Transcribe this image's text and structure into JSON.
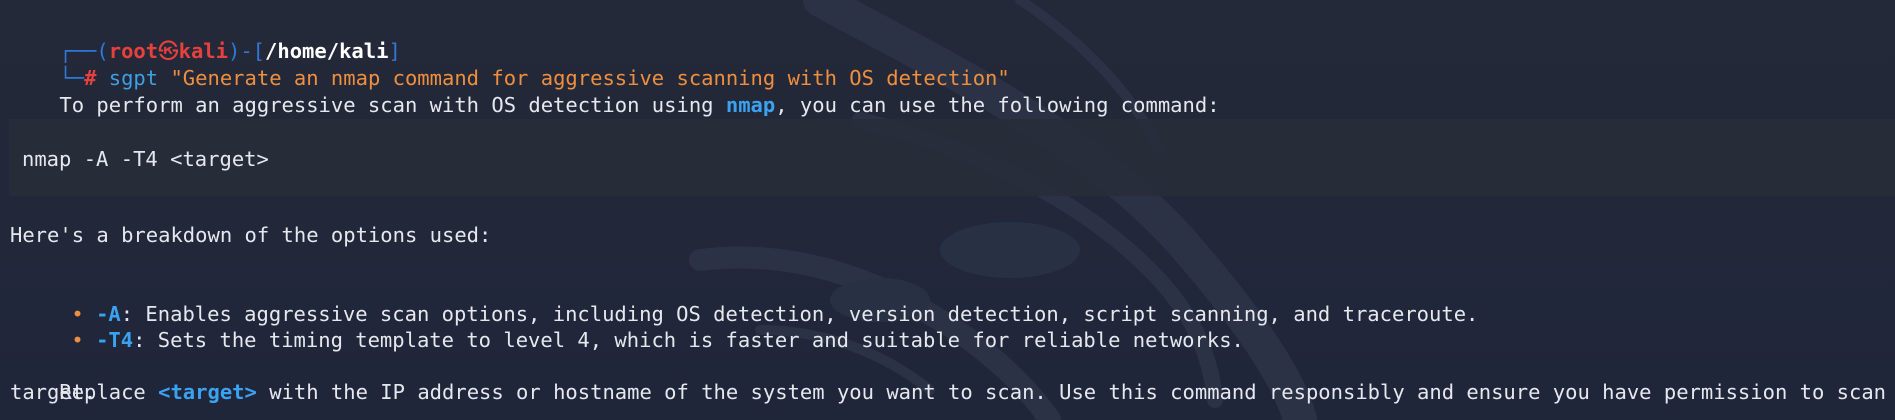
{
  "prompt": {
    "box_top": "┌──(",
    "user": "root",
    "skull": "㉿",
    "host": "kali",
    "close_paren": ")-[",
    "path": "/home/kali",
    "close_bracket": "]",
    "box_bottom": "└─",
    "hash": "#",
    "command": "sgpt",
    "argument": "\"Generate an nmap command for aggressive scanning with OS detection\""
  },
  "output": {
    "intro_before": "To perform an aggressive scan with OS detection using ",
    "intro_highlight": "nmap",
    "intro_after": ", you can use the following command:",
    "code": "nmap -A -T4 <target>",
    "breakdown_heading": "Here's a breakdown of the options used:",
    "bullets": [
      {
        "marker": "•",
        "option": "-A",
        "text": ": Enables aggressive scan options, including OS detection, version detection, script scanning, and traceroute."
      },
      {
        "marker": "•",
        "option": "-T4",
        "text": ": Sets the timing template to level 4, which is faster and suitable for reliable networks."
      }
    ],
    "replace_before": "Replace ",
    "replace_highlight": "<target>",
    "replace_after": " with the IP address or hostname of the system you want to scan. Use this command responsibly and ensure you have permission to scan the",
    "replace_continuation": "target."
  },
  "colors": {
    "background": "#232838",
    "prompt_box": "#2f78d7",
    "prompt_user": "#e7413d",
    "command": "#3d9fe4",
    "argument": "#ef8f3e",
    "highlight": "#3aa2f0",
    "bullet": "#ef8f3e",
    "text": "#e6e8ee"
  },
  "icons": {
    "background": "kali-dragon-watermark"
  }
}
